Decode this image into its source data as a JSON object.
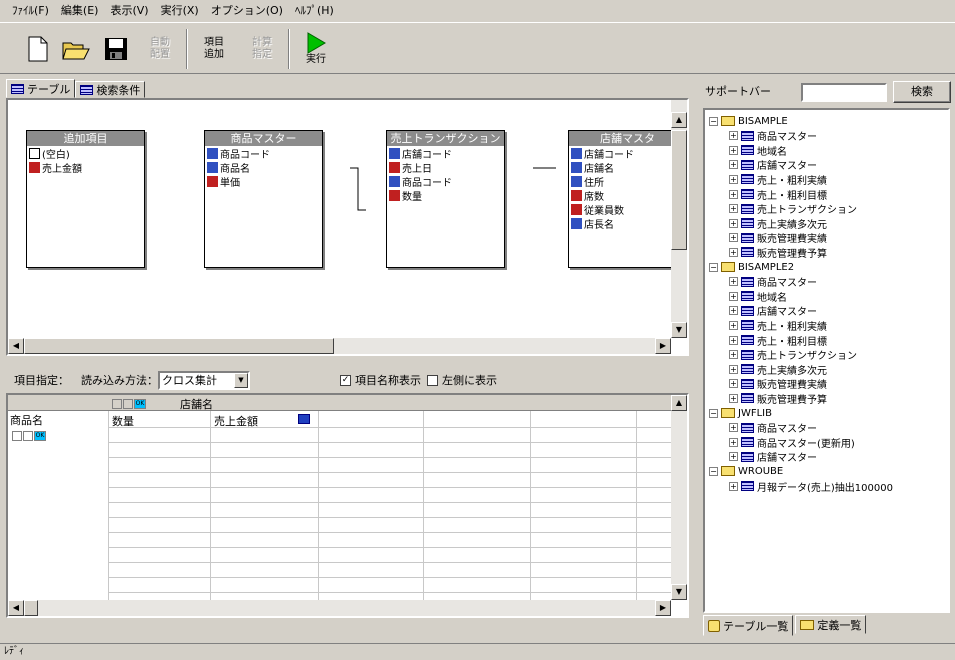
{
  "menu": [
    "ﾌｧｲﾙ(F)",
    "編集(E)",
    "表示(V)",
    "実行(X)",
    "オプション(O)",
    "ﾍﾙﾌﾟ(H)"
  ],
  "toolbar": {
    "auto_layout": [
      "自動",
      "配置"
    ],
    "add_item": [
      "項目",
      "追加"
    ],
    "calc_spec": [
      "計算",
      "指定"
    ],
    "run": "実行"
  },
  "tabs": [
    "テーブル",
    "検索条件"
  ],
  "tables": [
    {
      "title": "追加項目",
      "fields": [
        {
          "icon": "blank",
          "name": "(空白)"
        },
        {
          "icon": "num",
          "name": "売上金額"
        }
      ]
    },
    {
      "title": "商品マスター",
      "fields": [
        {
          "icon": "ab",
          "name": "商品コード"
        },
        {
          "icon": "ab",
          "name": "商品名"
        },
        {
          "icon": "num",
          "name": "単価"
        }
      ]
    },
    {
      "title": "売上トランザクション",
      "fields": [
        {
          "icon": "ab",
          "name": "店舗コード"
        },
        {
          "icon": "num",
          "name": "売上日"
        },
        {
          "icon": "ab",
          "name": "商品コード"
        },
        {
          "icon": "num",
          "name": "数量"
        }
      ]
    },
    {
      "title": "店舗マスタ",
      "fields": [
        {
          "icon": "ab",
          "name": "店舗コード"
        },
        {
          "icon": "ab",
          "name": "店舗名"
        },
        {
          "icon": "ab",
          "name": "住所"
        },
        {
          "icon": "num",
          "name": "席数"
        },
        {
          "icon": "num",
          "name": "従業員数"
        },
        {
          "icon": "ab",
          "name": "店長名"
        }
      ]
    }
  ],
  "item_spec": {
    "label": "項目指定：",
    "read_method_label": "読み込み方法：",
    "read_method_value": "クロス集計",
    "show_item_name_label": "項目名称表示",
    "show_item_name_checked": true,
    "show_left_label": "左側に表示",
    "show_left_checked": false
  },
  "grid": {
    "col_header": "店舗名",
    "row_header": "商品名",
    "columns": [
      "数量",
      "売上金額"
    ],
    "ok": "OK"
  },
  "support": {
    "title": "サポートバー",
    "search_value": "",
    "search_button": "検索",
    "tree": [
      {
        "level": 0,
        "type": "folder",
        "label": "BISAMPLE",
        "expanded": true
      },
      {
        "level": 1,
        "type": "table",
        "label": "商品マスター"
      },
      {
        "level": 1,
        "type": "table",
        "label": "地域名"
      },
      {
        "level": 1,
        "type": "table",
        "label": "店舗マスター"
      },
      {
        "level": 1,
        "type": "table",
        "label": "売上・粗利実績"
      },
      {
        "level": 1,
        "type": "table",
        "label": "売上・粗利目標"
      },
      {
        "level": 1,
        "type": "table",
        "label": "売上トランザクション"
      },
      {
        "level": 1,
        "type": "table",
        "label": "売上実績多次元"
      },
      {
        "level": 1,
        "type": "table",
        "label": "販売管理費実績"
      },
      {
        "level": 1,
        "type": "table",
        "label": "販売管理費予算"
      },
      {
        "level": 0,
        "type": "folder",
        "label": "BISAMPLE2",
        "expanded": true
      },
      {
        "level": 1,
        "type": "table",
        "label": "商品マスター"
      },
      {
        "level": 1,
        "type": "table",
        "label": "地域名"
      },
      {
        "level": 1,
        "type": "table",
        "label": "店舗マスター"
      },
      {
        "level": 1,
        "type": "table",
        "label": "売上・粗利実績"
      },
      {
        "level": 1,
        "type": "table",
        "label": "売上・粗利目標"
      },
      {
        "level": 1,
        "type": "table",
        "label": "売上トランザクション"
      },
      {
        "level": 1,
        "type": "table",
        "label": "売上実績多次元"
      },
      {
        "level": 1,
        "type": "table",
        "label": "販売管理費実績"
      },
      {
        "level": 1,
        "type": "table",
        "label": "販売管理費予算"
      },
      {
        "level": 0,
        "type": "folder",
        "label": "JWFLIB",
        "expanded": true
      },
      {
        "level": 1,
        "type": "table",
        "label": "商品マスター"
      },
      {
        "level": 1,
        "type": "table",
        "label": "商品マスター(更新用)"
      },
      {
        "level": 1,
        "type": "table",
        "label": "店舗マスター"
      },
      {
        "level": 0,
        "type": "folder",
        "label": "WROUBE",
        "expanded": true
      },
      {
        "level": 1,
        "type": "table",
        "label": "月報データ(売上)抽出100000"
      }
    ],
    "bottom_tabs": [
      "テーブル一覧",
      "定義一覧"
    ]
  },
  "status": "ﾚﾃﾞｨ"
}
